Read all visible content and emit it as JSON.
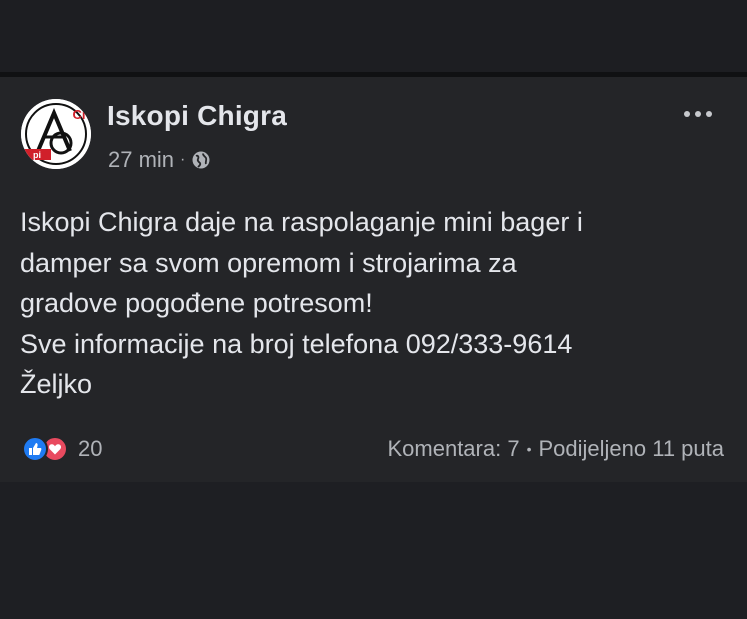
{
  "post": {
    "author": "Iskopi Chigra",
    "time": "27 min",
    "meta_separator": "·",
    "privacy_icon": "globe-icon",
    "avatar_logo_text": "ACi",
    "body_lines": [
      "Iskopi Chigra daje na raspolaganje mini bager i",
      "damper sa svom opremom i strojarima za",
      "gradove pogođene potresom!",
      "Sve informacije na broj telefona 092/333-9614",
      "Željko"
    ],
    "reactions": {
      "icons": [
        "like-icon",
        "love-icon"
      ],
      "count": "20"
    },
    "comments": "Komentara: 7",
    "stats_separator": "•",
    "shares": "Podijeljeno 11 puta"
  },
  "colors": {
    "background": "#1c1d21",
    "post_background": "#242528",
    "text_primary": "#e4e6eb",
    "text_secondary": "#b0b3b8",
    "like_blue": "#1f7bf2",
    "love_red": "#e84a5f",
    "logo_red": "#d0202a"
  }
}
